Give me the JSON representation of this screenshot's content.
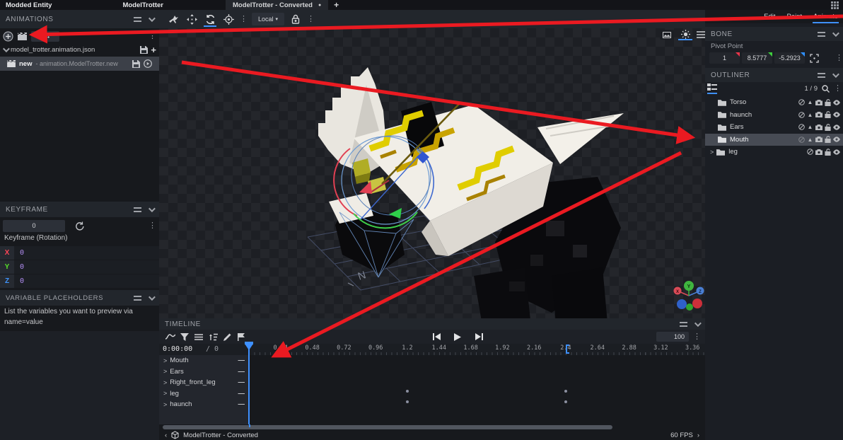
{
  "window": {
    "app_title": "Modded Entity",
    "model_name": "ModelTrotter",
    "tab_label": "ModelTrotter - Converted",
    "tab_unsaved_dot": "●",
    "new_tab_label": "+"
  },
  "mode_tabs": {
    "edit": "Edit",
    "paint": "Paint",
    "animate": "Animate",
    "active": "Animate"
  },
  "animations_panel": {
    "title": "ANIMATIONS",
    "length_value": "2.4",
    "file_name": "model_trotter.animation.json",
    "anim_name": "new",
    "anim_path": "- animation.ModelTrotter.new",
    "add_label": "+"
  },
  "keyframe_panel": {
    "title": "KEYFRAME",
    "time_value": "0",
    "label": "Keyframe (Rotation)",
    "axes": [
      {
        "axis": "X",
        "value": "0",
        "color": "#ff4758"
      },
      {
        "axis": "Y",
        "value": "0",
        "color": "#56e02a"
      },
      {
        "axis": "Z",
        "value": "0",
        "color": "#3f96ff"
      }
    ]
  },
  "variables_panel": {
    "title": "VARIABLE PLACEHOLDERS",
    "hint": "List the variables you want to preview via name=value"
  },
  "viewport_toolbar": {
    "space_mode": "Local",
    "caret": "▾"
  },
  "bone_panel": {
    "title": "BONE",
    "pivot_label": "Pivot Point",
    "pivot_x": "1",
    "pivot_y": "8.5777",
    "pivot_z": "-5.2923"
  },
  "outliner": {
    "title": "OUTLINER",
    "counter": "1 / 9",
    "items": [
      {
        "label": "Torso"
      },
      {
        "label": "haunch"
      },
      {
        "label": "Ears"
      },
      {
        "label": "Mouth"
      },
      {
        "label": "leg"
      }
    ],
    "selected": "Mouth",
    "leg_chevron": ">"
  },
  "timeline": {
    "title": "TIMELINE",
    "time_display": "0:00:00",
    "frame_display": "/  0",
    "zoom_value": "100",
    "end_marker_t": 2.4,
    "ruler_ticks": [
      "0.24",
      "0.48",
      "0.72",
      "0.96",
      "1.2",
      "1.44",
      "1.68",
      "1.92",
      "2.16",
      "2.4",
      "2.64",
      "2.88",
      "3.12",
      "3.36"
    ],
    "channels": [
      {
        "label": "Mouth"
      },
      {
        "label": "Ears"
      },
      {
        "label": "Right_front_leg"
      },
      {
        "label": "leg"
      },
      {
        "label": "haunch"
      }
    ],
    "channel_chevron": ">",
    "channel_remove": "—",
    "keyframe_dots": [
      {
        "row": 3,
        "t": 1.2
      },
      {
        "row": 4,
        "t": 1.2
      },
      {
        "row": 3,
        "t": 2.4
      },
      {
        "row": 4,
        "t": 2.4
      }
    ]
  },
  "status_bar": {
    "back": "‹",
    "title": "ModelTrotter - Converted",
    "fps": "60 FPS",
    "forward": "›"
  },
  "colors": {
    "accent": "#3e90ff",
    "annotation_arrow": "#ea1a21",
    "axis_x": "#ff4758",
    "axis_y": "#56e02a",
    "axis_z": "#3f96ff"
  }
}
